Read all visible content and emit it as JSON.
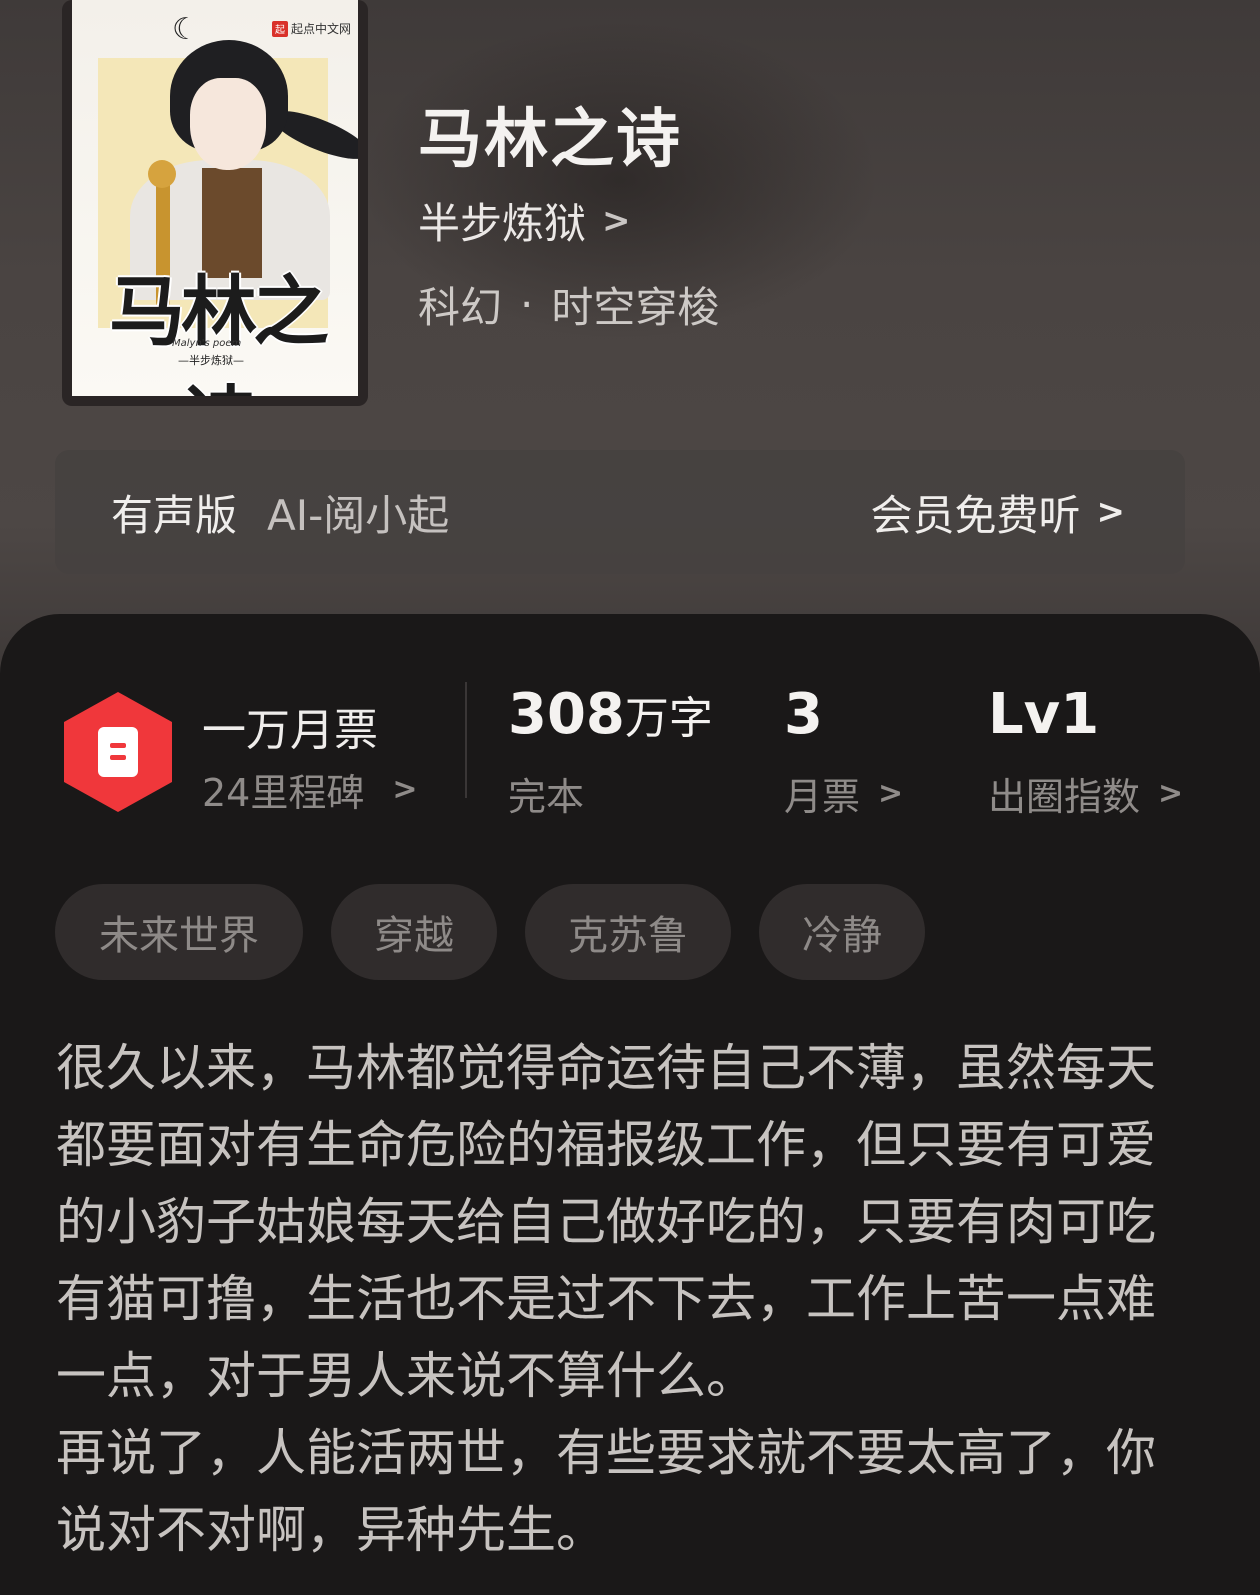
{
  "cover": {
    "publisher": "起点中文网",
    "publisher_mark": "起",
    "title_art": "马林之诗",
    "subtitle_art": "Malyn's poem",
    "author_art": "—半步炼狱—"
  },
  "book": {
    "title": "马林之诗",
    "author": "半步炼狱",
    "genre": "科幻",
    "subgenre": "时空穿梭",
    "separator": "·"
  },
  "audio": {
    "label": "有声版",
    "voice": "AI-阅小起",
    "action": "会员免费听"
  },
  "stats": {
    "monthly_ticket_title": "一万月票",
    "milestone": "24里程碑",
    "word_count_number": "308",
    "word_count_unit": "万字",
    "status": "完本",
    "monthly_votes": "3",
    "monthly_votes_label": "月票",
    "level": "Lv1",
    "level_label": "出圈指数"
  },
  "tags": [
    "未来世界",
    "穿越",
    "克苏鲁",
    "冷静"
  ],
  "description": [
    "很久以来，马林都觉得命运待自己不薄，虽然每天都要面对有生命危险的福报级工作，但只要有可爱的小豹子姑娘每天给自己做好吃的，只要有肉可吃有猫可撸，生活也不是过不下去，工作上苦一点难一点，对于男人来说不算什么。",
    "再说了，人能活两世，有些要求就不要太高了，你说对不对啊，异种先生。"
  ],
  "icons": {
    "chevron": "chevron-right-icon",
    "ticket": "ticket-icon",
    "moon": "crescent-moon-icon"
  },
  "colors": {
    "accent_red": "#f0373b",
    "background_dark": "#1a1818",
    "tag_bg": "#302c2c"
  }
}
